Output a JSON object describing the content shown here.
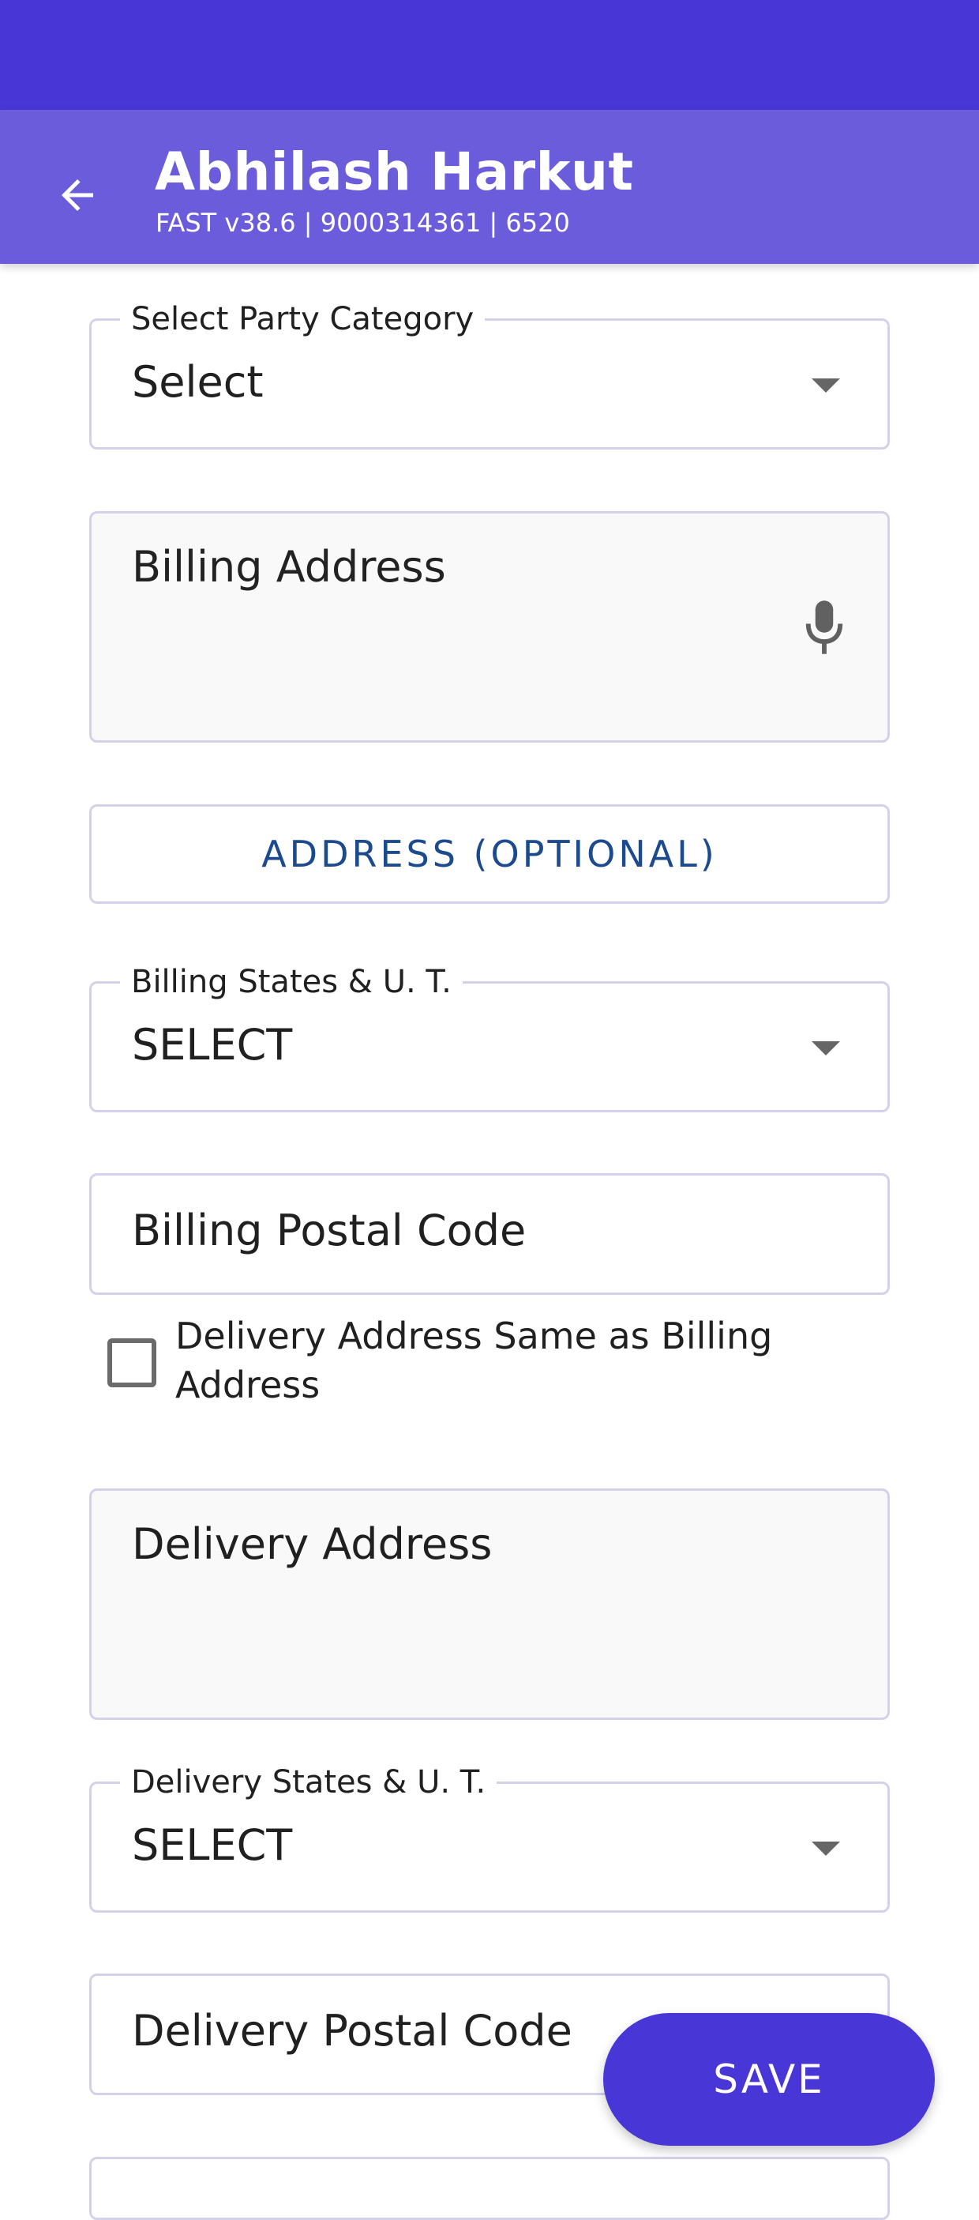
{
  "header": {
    "title": "Abhilash Harkut",
    "subtitle": "FAST v38.6 | 9000314361 | 6520"
  },
  "form": {
    "party_category": {
      "label": "Select Party Category",
      "value": "Select"
    },
    "billing_address": {
      "placeholder": "Billing Address"
    },
    "address_optional_button": "ADDRESS (OPTIONAL)",
    "billing_state": {
      "label": "Billing States & U. T.",
      "value": "SELECT"
    },
    "billing_postal_code": {
      "placeholder": "Billing Postal Code"
    },
    "same_as_billing": {
      "label": "Delivery Address Same as Billing Address",
      "checked": false
    },
    "delivery_address": {
      "placeholder": "Delivery Address"
    },
    "delivery_state": {
      "label": "Delivery States & U. T.",
      "value": "SELECT"
    },
    "delivery_postal_code": {
      "placeholder": "Delivery Postal Code"
    }
  },
  "actions": {
    "save_label": "SAVE"
  },
  "colors": {
    "status_bar": "#4936d6",
    "app_bar": "#6b5cdb",
    "accent": "#4936d6",
    "link": "#1b4a8e"
  }
}
